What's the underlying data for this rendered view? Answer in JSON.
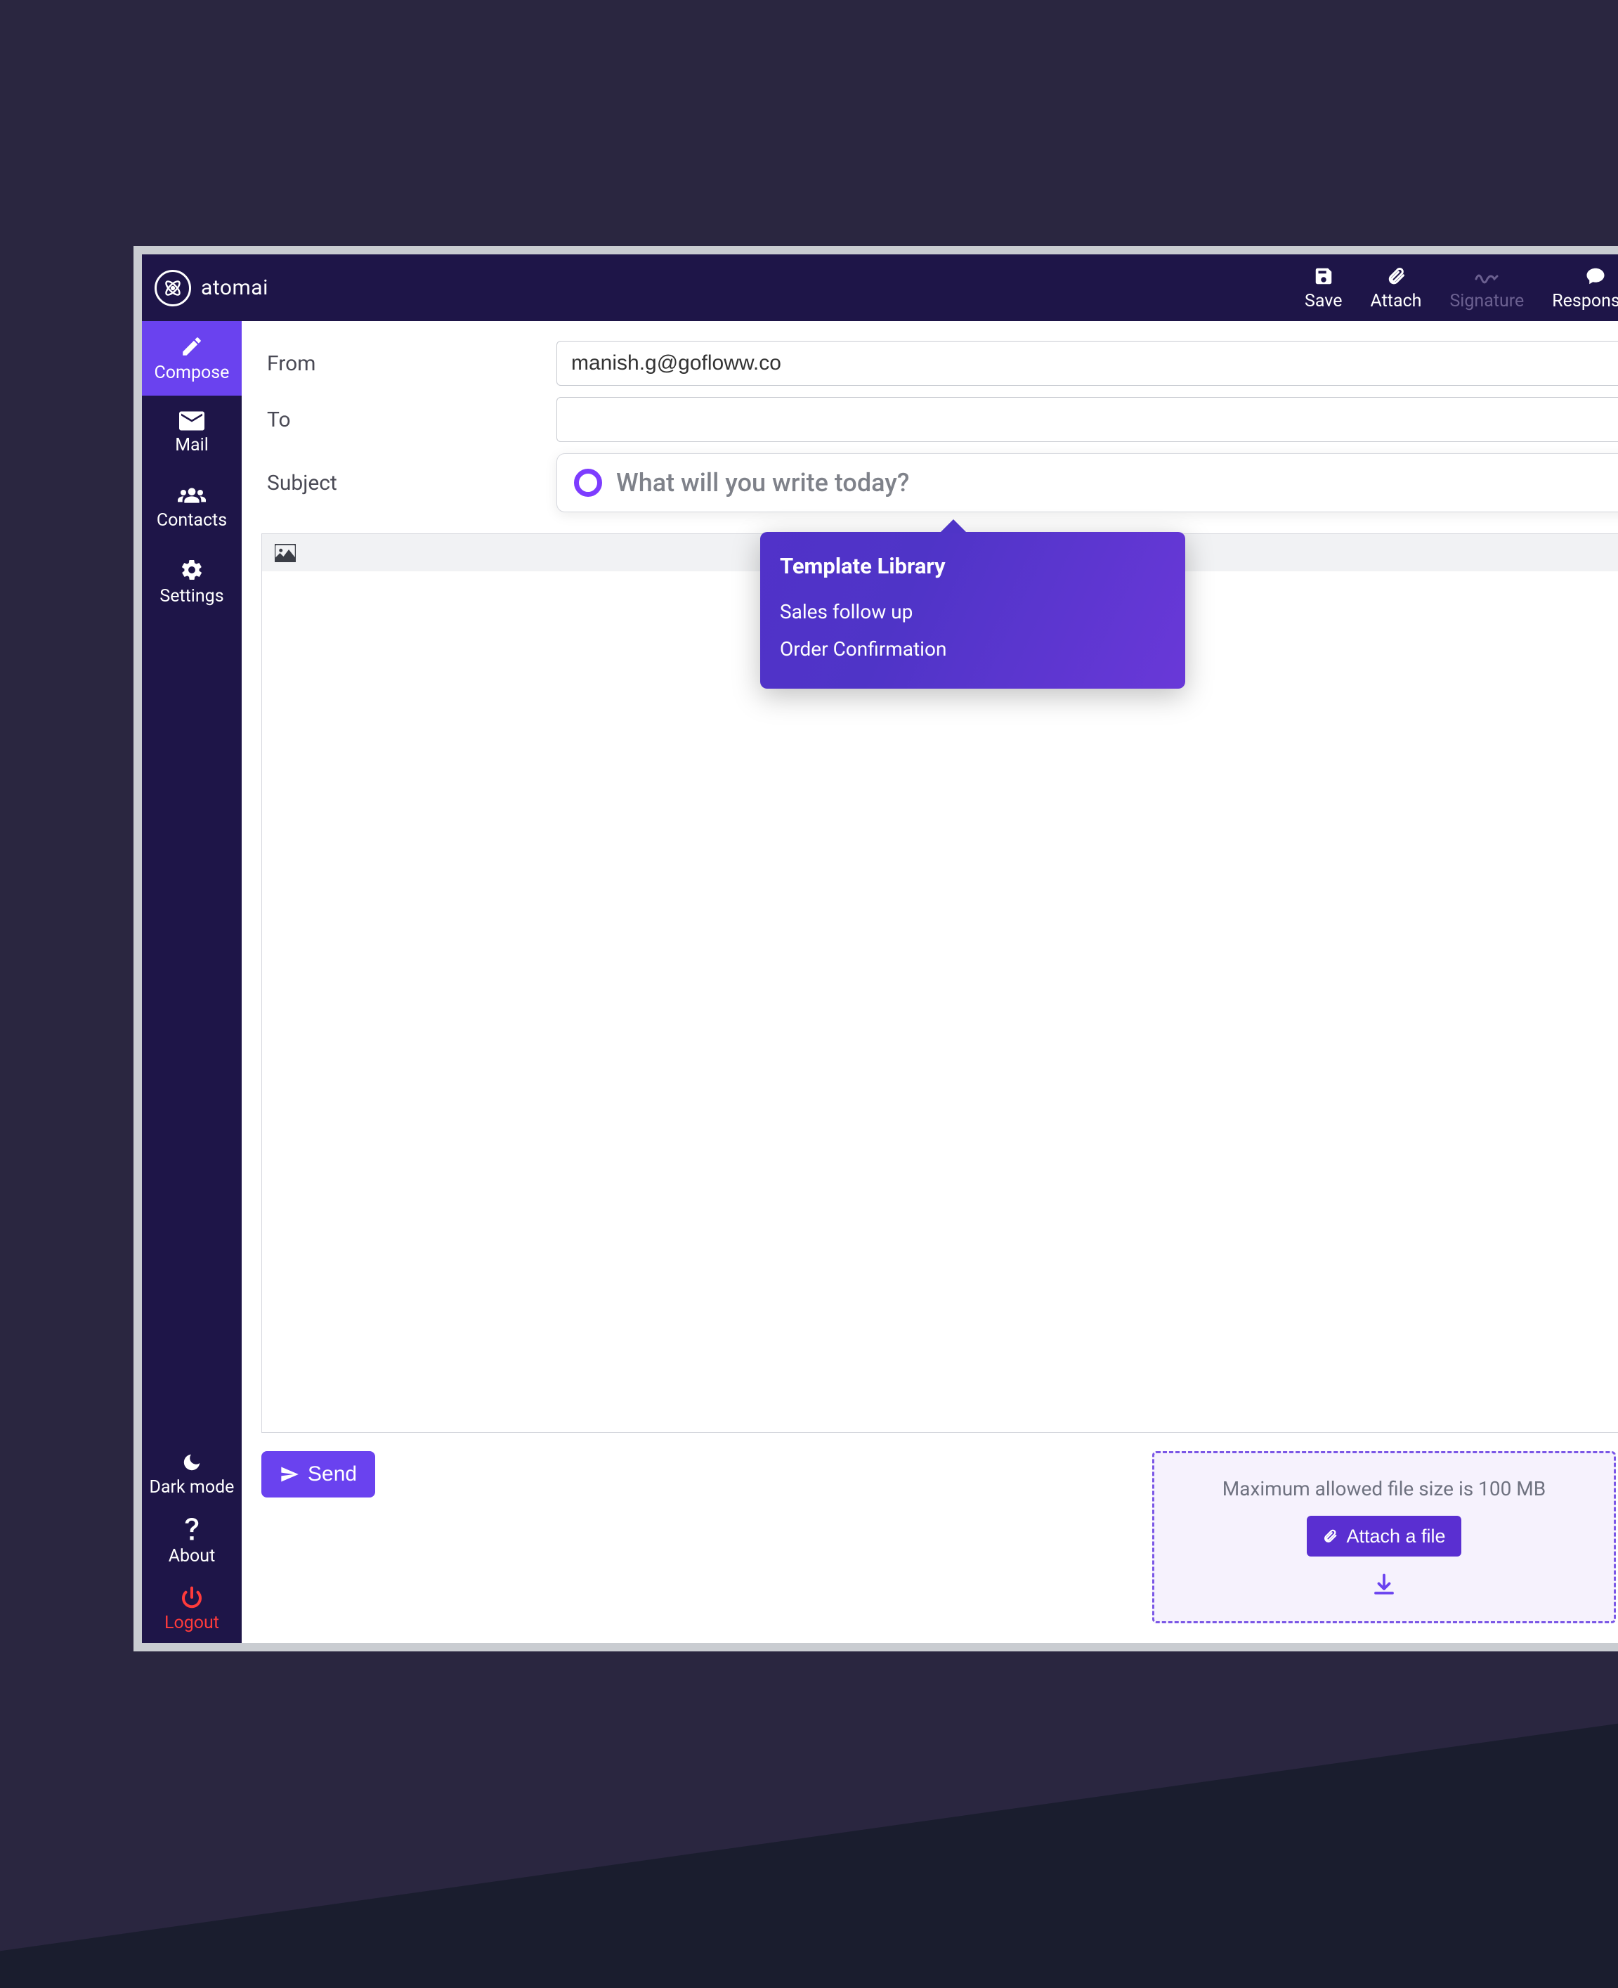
{
  "brand": {
    "name": "atomai"
  },
  "toolbar": {
    "save": {
      "label": "Save"
    },
    "attach": {
      "label": "Attach"
    },
    "signature": {
      "label": "Signature"
    },
    "responses": {
      "label": "Responses"
    }
  },
  "sidebar": {
    "compose": {
      "label": "Compose"
    },
    "mail": {
      "label": "Mail"
    },
    "contacts": {
      "label": "Contacts"
    },
    "settings": {
      "label": "Settings"
    },
    "darkmode": {
      "label": "Dark mode"
    },
    "about": {
      "label": "About"
    },
    "logout": {
      "label": "Logout"
    }
  },
  "compose": {
    "from_label": "From",
    "from_value": "manish.g@gofloww.co",
    "to_label": "To",
    "to_value": "",
    "subject_label": "Subject",
    "subject_placeholder": "What will you write today?"
  },
  "template_dropdown": {
    "title": "Template Library",
    "items": [
      "Sales follow up",
      "Order Confirmation"
    ]
  },
  "send_button": "Send",
  "attach_zone": {
    "hint": "Maximum allowed  file size is 100 MB",
    "button": "Attach a file"
  }
}
